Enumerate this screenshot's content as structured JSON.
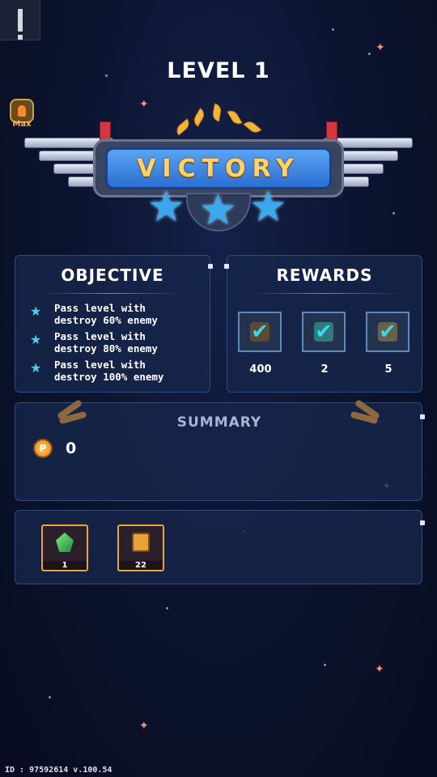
{
  "header": {
    "level_title": "LEVEL 1",
    "max_badge": "Max"
  },
  "banner": {
    "title": "VICTORY",
    "stars_earned": 3
  },
  "objective": {
    "title": "OBJECTIVE",
    "items": [
      {
        "line1": "Pass level with",
        "line2": "destroy 60% enemy"
      },
      {
        "line1": "Pass level with",
        "line2": "destroy 80% enemy"
      },
      {
        "line1": "Pass level with",
        "line2": "destroy 100% enemy"
      }
    ]
  },
  "rewards": {
    "title": "REWARDS",
    "items": [
      {
        "value": "400",
        "icon": "coin-reward-icon"
      },
      {
        "value": "2",
        "icon": "box-reward-icon"
      },
      {
        "value": "5",
        "icon": "ship-reward-icon"
      }
    ]
  },
  "summary": {
    "title": "SUMMARY",
    "coin_value": "0",
    "coin_symbol": "P"
  },
  "loot": [
    {
      "count": "1",
      "icon": "green-gem-icon"
    },
    {
      "count": "22",
      "icon": "chest-icon"
    }
  ],
  "footer": {
    "build_id": "ID : 97592614 v.100.54"
  },
  "colors": {
    "accent_gold": "#ffd36a",
    "panel_bg": "#16264a",
    "check_cyan": "#3fd3e6",
    "victory_blue": "#3b8ae6"
  }
}
